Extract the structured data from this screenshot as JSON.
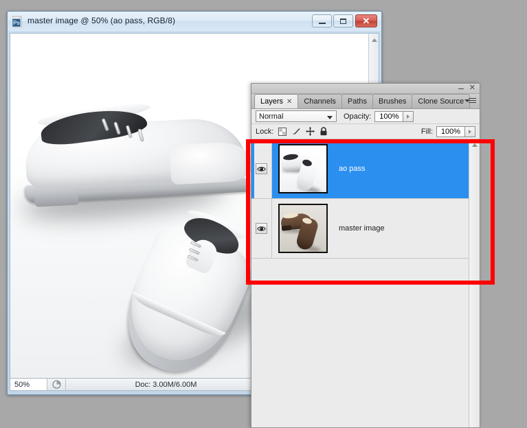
{
  "document_window": {
    "title": "master image @ 50% (ao pass, RGB/8)",
    "icon": "photoshop-document-icon",
    "controls": {
      "minimize": "minimize-icon",
      "maximize": "maximize-icon",
      "close": "close-icon",
      "close_glyph": "✕"
    },
    "statusbar": {
      "zoom_level": "50%",
      "preview_icon": "document-preview-icon",
      "doc_size": "Doc: 3.00M/6.00M",
      "expand_arrow": "right-triangle-icon",
      "resize_arrow": "left-triangle-icon"
    }
  },
  "layers_panel": {
    "window_controls": {
      "minimize": "minimize-icon",
      "close": "✕"
    },
    "menu_icon": "panel-menu-icon",
    "tabs": [
      {
        "label": "Layers",
        "active": true,
        "close_glyph": "✕"
      },
      {
        "label": "Channels",
        "active": false
      },
      {
        "label": "Paths",
        "active": false
      },
      {
        "label": "Brushes",
        "active": false
      },
      {
        "label": "Clone Source",
        "active": false
      }
    ],
    "blend_mode": {
      "value": "Normal",
      "caret": "chevron-down-icon"
    },
    "opacity": {
      "label": "Opacity:",
      "value": "100%",
      "stepper": "right-triangle-icon"
    },
    "fill": {
      "label": "Fill:",
      "value": "100%",
      "stepper": "right-triangle-icon"
    },
    "lock": {
      "label": "Lock:",
      "icons": [
        "lock-transparency-icon",
        "lock-pixels-icon",
        "lock-position-icon",
        "lock-all-icon"
      ]
    },
    "layers": [
      {
        "name": "ao pass",
        "selected": true,
        "visible": true,
        "visibility_icon": "eye-icon",
        "thumbnail": "ao-pass-thumbnail"
      },
      {
        "name": "master image",
        "selected": false,
        "visible": true,
        "visibility_icon": "eye-icon",
        "thumbnail": "master-image-thumbnail"
      }
    ],
    "scrollbar": {
      "up_arrow": "scroll-up-icon"
    }
  },
  "annotation": {
    "type": "red-rectangle-highlight",
    "color": "#ff0000",
    "target": "layers-list"
  },
  "colors": {
    "selection_blue": "#2b8fef",
    "annotation_red": "#ff0000",
    "panel_gray": "#ebebeb",
    "desktop_gray": "#a8a8a8",
    "titlebar_blue": "#cfe0ef"
  }
}
